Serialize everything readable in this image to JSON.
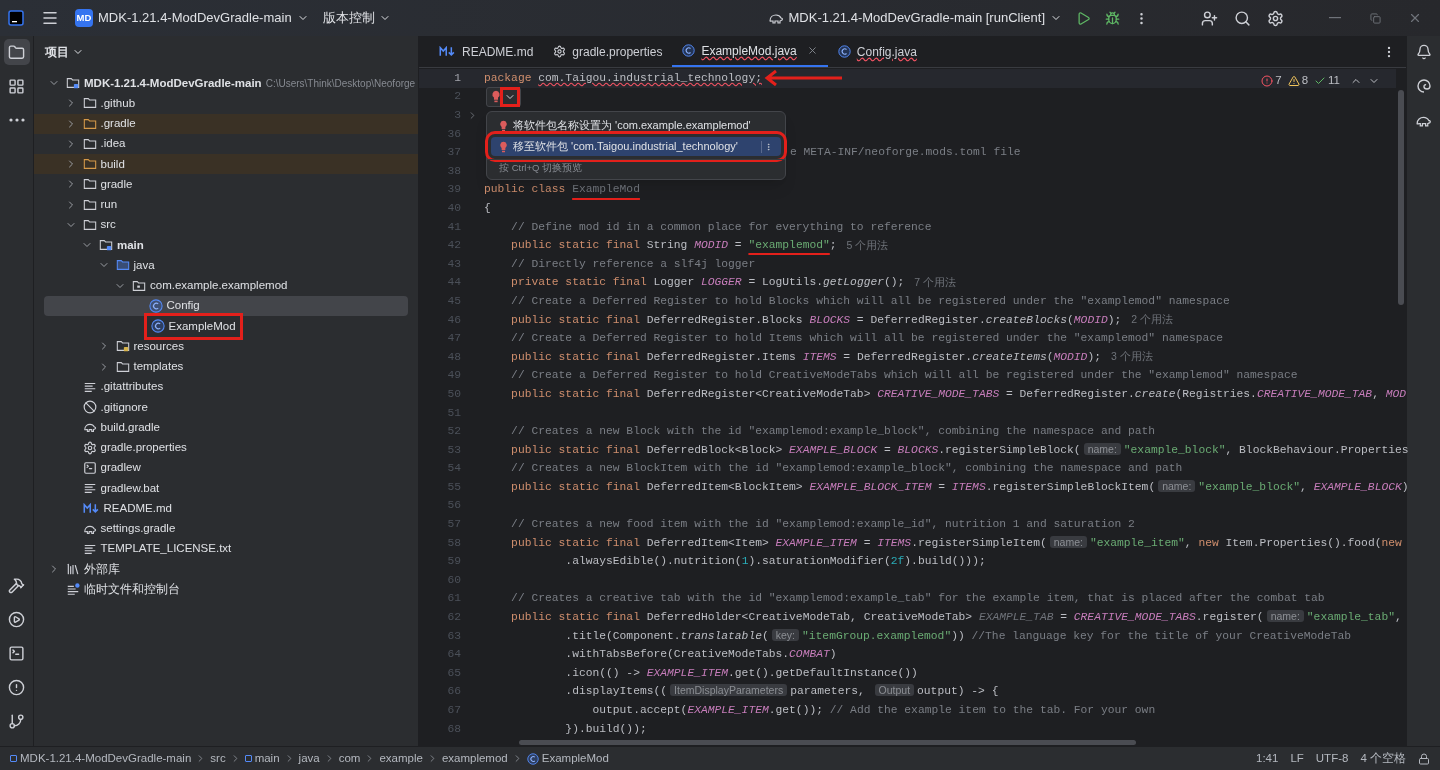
{
  "title_bar": {
    "project_badge": "MD",
    "project": "MDK-1.21.4-ModDevGradle-main",
    "vcs": "版本控制",
    "run_config": "MDK-1.21.4-ModDevGradle-main [runClient]"
  },
  "left_toolbar": [
    {
      "kind": "folder",
      "selected": true
    },
    {
      "kind": "structure",
      "selected": false
    },
    {
      "kind": "more",
      "selected": false
    }
  ],
  "left_toolbar_bottom": [
    {
      "kind": "build",
      "selected": false
    },
    {
      "kind": "run",
      "selected": false
    },
    {
      "kind": "terminal",
      "selected": false
    },
    {
      "kind": "problems",
      "selected": false
    },
    {
      "kind": "git",
      "selected": false
    }
  ],
  "right_toolbar": [
    {
      "kind": "notifications",
      "selected": false
    },
    {
      "kind": "assistant",
      "selected": false
    },
    {
      "kind": "gradle",
      "selected": false
    }
  ],
  "project_panel": {
    "title": "项目",
    "tree": [
      {
        "label": "MDK-1.21.4-ModDevGradle-main",
        "path": "C:\\Users\\Think\\Desktop\\Neoforge",
        "kind": "module",
        "bold": true,
        "expanded": true,
        "selected": false,
        "annotated": false,
        "children": [
          {
            "label": ".github",
            "kind": "folder",
            "bold": false,
            "expanded": false,
            "selected": false,
            "annotated": false
          },
          {
            "label": ".gradle",
            "kind": "excluded",
            "bold": false,
            "expanded": false,
            "selected": false,
            "annotated": false
          },
          {
            "label": ".idea",
            "kind": "folder",
            "bold": false,
            "expanded": false,
            "selected": false,
            "annotated": false
          },
          {
            "label": "build",
            "kind": "excluded",
            "bold": false,
            "expanded": false,
            "selected": false,
            "annotated": false
          },
          {
            "label": "gradle",
            "kind": "folder",
            "bold": false,
            "expanded": false,
            "selected": false,
            "annotated": false
          },
          {
            "label": "run",
            "kind": "folder",
            "bold": false,
            "expanded": false,
            "selected": false,
            "annotated": false
          },
          {
            "label": "src",
            "kind": "folder",
            "bold": false,
            "expanded": true,
            "selected": false,
            "annotated": false,
            "children": [
              {
                "label": "main",
                "kind": "module",
                "bold": true,
                "expanded": true,
                "selected": false,
                "annotated": false,
                "children": [
                  {
                    "label": "java",
                    "kind": "source",
                    "bold": false,
                    "expanded": true,
                    "selected": false,
                    "annotated": false,
                    "children": [
                      {
                        "label": "com.example.examplemod",
                        "kind": "package",
                        "bold": false,
                        "expanded": true,
                        "selected": false,
                        "annotated": false,
                        "children": [
                          {
                            "label": "Config",
                            "kind": "class",
                            "bold": false,
                            "selected": true,
                            "annotated": false
                          },
                          {
                            "label": "ExampleMod",
                            "kind": "class",
                            "bold": false,
                            "selected": false,
                            "annotated": true
                          }
                        ]
                      }
                    ]
                  },
                  {
                    "label": "resources",
                    "kind": "resources",
                    "bold": false,
                    "expanded": false,
                    "selected": false,
                    "annotated": false
                  },
                  {
                    "label": "templates",
                    "kind": "folder",
                    "bold": false,
                    "expanded": false,
                    "selected": false,
                    "annotated": false
                  }
                ]
              }
            ]
          },
          {
            "label": ".gitattributes",
            "kind": "text",
            "bold": false,
            "selected": false,
            "annotated": false
          },
          {
            "label": ".gitignore",
            "kind": "ignore",
            "bold": false,
            "selected": false,
            "annotated": false
          },
          {
            "label": "build.gradle",
            "kind": "gradle",
            "bold": false,
            "selected": false,
            "annotated": false
          },
          {
            "label": "gradle.properties",
            "kind": "settings",
            "bold": false,
            "selected": false,
            "annotated": false
          },
          {
            "label": "gradlew",
            "kind": "terminal",
            "bold": false,
            "selected": false,
            "annotated": false
          },
          {
            "label": "gradlew.bat",
            "kind": "text",
            "bold": false,
            "selected": false,
            "annotated": false
          },
          {
            "label": "README.md",
            "kind": "markdown",
            "bold": false,
            "selected": false,
            "annotated": false
          },
          {
            "label": "settings.gradle",
            "kind": "gradle",
            "bold": false,
            "selected": false,
            "annotated": false
          },
          {
            "label": "TEMPLATE_LICENSE.txt",
            "kind": "text",
            "bold": false,
            "selected": false,
            "annotated": false
          }
        ]
      },
      {
        "label": "外部库",
        "kind": "library",
        "bold": false,
        "expanded": false,
        "selected": false,
        "annotated": false
      },
      {
        "label": "临时文件和控制台",
        "kind": "scratch",
        "bold": false,
        "selected": false,
        "annotated": false
      }
    ]
  },
  "editor": {
    "tabs": [
      {
        "label": "README.md",
        "kind": "markdown",
        "selected": false,
        "error": false
      },
      {
        "label": "gradle.properties",
        "kind": "settings",
        "selected": false,
        "error": false
      },
      {
        "label": "ExampleMod.java",
        "kind": "class",
        "selected": true,
        "error": true
      },
      {
        "label": "Config.java",
        "kind": "class",
        "selected": false,
        "error": true
      }
    ],
    "inspections": {
      "errors": "7",
      "warnings": "8",
      "ok": "11"
    },
    "lines": [
      {
        "number": "1",
        "kind": "code",
        "current": true,
        "tokens": [
          {
            "kind": "keyword",
            "text": "package "
          },
          {
            "kind": "error",
            "text": "com.Taigou.industrial_technology;"
          },
          {
            "kind": "arrow"
          }
        ]
      },
      {
        "number": "2",
        "kind": "intention",
        "current": false,
        "annotated": true
      },
      {
        "number": "3",
        "kind": "fold",
        "current": false
      },
      {
        "number": "36",
        "kind": "code",
        "current": false
      },
      {
        "number": "37",
        "kind": "covered",
        "current": false,
        "tokens": [
          {
            "kind": "comment",
            "text": "e META-INF/neoforge.mods.toml file"
          }
        ]
      },
      {
        "number": "38",
        "kind": "code",
        "current": false
      },
      {
        "number": "39",
        "kind": "code",
        "current": false,
        "tokens": [
          {
            "kind": "keyword",
            "text": "public class "
          },
          {
            "kind": "unused-marked",
            "text": "ExampleMod"
          }
        ]
      },
      {
        "number": "40",
        "kind": "code",
        "current": false,
        "tokens": [
          {
            "kind": "plain",
            "text": "{"
          }
        ]
      },
      {
        "number": "41",
        "kind": "code",
        "current": false,
        "tokens": [
          {
            "kind": "comment",
            "text": "    // Define mod id in a common place for everything to reference"
          }
        ]
      },
      {
        "number": "42",
        "kind": "code",
        "current": false,
        "tokens": [
          {
            "kind": "keyword",
            "text": "    public static final "
          },
          {
            "kind": "plain",
            "text": "String "
          },
          {
            "kind": "field",
            "text": "MODID"
          },
          {
            "kind": "plain",
            "text": " = "
          },
          {
            "kind": "string-marked",
            "text": "\"examplemod\""
          },
          {
            "kind": "plain",
            "text": ";"
          },
          {
            "kind": "usage",
            "text": "5 个用法"
          }
        ]
      },
      {
        "number": "43",
        "kind": "code",
        "current": false,
        "tokens": [
          {
            "kind": "comment",
            "text": "    // Directly reference a slf4j logger"
          }
        ]
      },
      {
        "number": "44",
        "kind": "code",
        "current": false,
        "tokens": [
          {
            "kind": "keyword",
            "text": "    private static final "
          },
          {
            "kind": "plain",
            "text": "Logger "
          },
          {
            "kind": "field",
            "text": "LOGGER"
          },
          {
            "kind": "plain",
            "text": " = LogUtils."
          },
          {
            "kind": "method",
            "text": "getLogger"
          },
          {
            "kind": "plain",
            "text": "();"
          },
          {
            "kind": "usage",
            "text": "7 个用法"
          }
        ]
      },
      {
        "number": "45",
        "kind": "code",
        "current": false,
        "tokens": [
          {
            "kind": "comment",
            "text": "    // Create a Deferred Register to hold Blocks which will all be registered under the \"examplemod\" namespace"
          }
        ]
      },
      {
        "number": "46",
        "kind": "code",
        "current": false,
        "tokens": [
          {
            "kind": "keyword",
            "text": "    public static final "
          },
          {
            "kind": "plain",
            "text": "DeferredRegister.Blocks "
          },
          {
            "kind": "field",
            "text": "BLOCKS"
          },
          {
            "kind": "plain",
            "text": " = DeferredRegister."
          },
          {
            "kind": "method",
            "text": "createBlocks"
          },
          {
            "kind": "plain",
            "text": "("
          },
          {
            "kind": "field",
            "text": "MODID"
          },
          {
            "kind": "plain",
            "text": ");"
          },
          {
            "kind": "usage",
            "text": "2 个用法"
          }
        ]
      },
      {
        "number": "47",
        "kind": "code",
        "current": false,
        "tokens": [
          {
            "kind": "comment",
            "text": "    // Create a Deferred Register to hold Items which will all be registered under the \"examplemod\" namespace"
          }
        ]
      },
      {
        "number": "48",
        "kind": "code",
        "current": false,
        "tokens": [
          {
            "kind": "keyword",
            "text": "    public static final "
          },
          {
            "kind": "plain",
            "text": "DeferredRegister.Items "
          },
          {
            "kind": "field",
            "text": "ITEMS"
          },
          {
            "kind": "plain",
            "text": " = DeferredRegister."
          },
          {
            "kind": "method",
            "text": "createItems"
          },
          {
            "kind": "plain",
            "text": "("
          },
          {
            "kind": "field",
            "text": "MODID"
          },
          {
            "kind": "plain",
            "text": ");"
          },
          {
            "kind": "usage",
            "text": "3 个用法"
          }
        ]
      },
      {
        "number": "49",
        "kind": "code",
        "current": false,
        "tokens": [
          {
            "kind": "comment",
            "text": "    // Create a Deferred Register to hold CreativeModeTabs which will all be registered under the \"examplemod\" namespace"
          }
        ]
      },
      {
        "number": "50",
        "kind": "code",
        "current": false,
        "tokens": [
          {
            "kind": "keyword",
            "text": "    public static final "
          },
          {
            "kind": "plain",
            "text": "DeferredRegister<CreativeModeTab> "
          },
          {
            "kind": "field",
            "text": "CREATIVE_MODE_TABS"
          },
          {
            "kind": "plain",
            "text": " = DeferredRegister."
          },
          {
            "kind": "method",
            "text": "create"
          },
          {
            "kind": "plain",
            "text": "(Registries."
          },
          {
            "kind": "field",
            "text": "CREATIVE_MODE_TAB"
          },
          {
            "kind": "plain",
            "text": ", "
          },
          {
            "kind": "field",
            "text": "MOD"
          }
        ]
      },
      {
        "number": "51",
        "kind": "code",
        "current": false
      },
      {
        "number": "52",
        "kind": "code",
        "current": false,
        "tokens": [
          {
            "kind": "comment",
            "text": "    // Creates a new Block with the id \"examplemod:example_block\", combining the namespace and path"
          }
        ]
      },
      {
        "number": "53",
        "kind": "code",
        "current": false,
        "tokens": [
          {
            "kind": "keyword",
            "text": "    public static final "
          },
          {
            "kind": "plain",
            "text": "DeferredBlock<Block> "
          },
          {
            "kind": "field",
            "text": "EXAMPLE_BLOCK"
          },
          {
            "kind": "plain",
            "text": " = "
          },
          {
            "kind": "field",
            "text": "BLOCKS"
          },
          {
            "kind": "plain",
            "text": ".registerSimpleBlock("
          },
          {
            "kind": "hint",
            "text": "name:"
          },
          {
            "kind": "string",
            "text": "\"example_block\""
          },
          {
            "kind": "plain",
            "text": ", BlockBehaviour.Properties"
          }
        ]
      },
      {
        "number": "54",
        "kind": "code",
        "current": false,
        "tokens": [
          {
            "kind": "comment",
            "text": "    // Creates a new BlockItem with the id \"examplemod:example_block\", combining the namespace and path"
          }
        ]
      },
      {
        "number": "55",
        "kind": "code",
        "current": false,
        "tokens": [
          {
            "kind": "keyword",
            "text": "    public static final "
          },
          {
            "kind": "plain",
            "text": "DeferredItem<BlockItem> "
          },
          {
            "kind": "field",
            "text": "EXAMPLE_BLOCK_ITEM"
          },
          {
            "kind": "plain",
            "text": " = "
          },
          {
            "kind": "field",
            "text": "ITEMS"
          },
          {
            "kind": "plain",
            "text": ".registerSimpleBlockItem("
          },
          {
            "kind": "hint",
            "text": "name:"
          },
          {
            "kind": "string",
            "text": "\"example_block\""
          },
          {
            "kind": "plain",
            "text": ", "
          },
          {
            "kind": "field",
            "text": "EXAMPLE_BLOCK"
          },
          {
            "kind": "plain",
            "text": ")"
          }
        ]
      },
      {
        "number": "56",
        "kind": "code",
        "current": false
      },
      {
        "number": "57",
        "kind": "code",
        "current": false,
        "tokens": [
          {
            "kind": "comment",
            "text": "    // Creates a new food item with the id \"examplemod:example_id\", nutrition 1 and saturation 2"
          }
        ]
      },
      {
        "number": "58",
        "kind": "code",
        "current": false,
        "tokens": [
          {
            "kind": "keyword",
            "text": "    public static final "
          },
          {
            "kind": "plain",
            "text": "DeferredItem<Item> "
          },
          {
            "kind": "field",
            "text": "EXAMPLE_ITEM"
          },
          {
            "kind": "plain",
            "text": " = "
          },
          {
            "kind": "field",
            "text": "ITEMS"
          },
          {
            "kind": "plain",
            "text": ".registerSimpleItem("
          },
          {
            "kind": "hint",
            "text": "name:"
          },
          {
            "kind": "string",
            "text": "\"example_item\""
          },
          {
            "kind": "plain",
            "text": ", "
          },
          {
            "kind": "keyword",
            "text": "new "
          },
          {
            "kind": "plain",
            "text": "Item.Properties().food("
          },
          {
            "kind": "keyword",
            "text": "new"
          }
        ]
      },
      {
        "number": "59",
        "kind": "code",
        "current": false,
        "tokens": [
          {
            "kind": "plain",
            "text": "            .alwaysEdible().nutrition("
          },
          {
            "kind": "number",
            "text": "1"
          },
          {
            "kind": "plain",
            "text": ").saturationModifier("
          },
          {
            "kind": "number",
            "text": "2f"
          },
          {
            "kind": "plain",
            "text": ").build()));"
          }
        ]
      },
      {
        "number": "60",
        "kind": "code",
        "current": false
      },
      {
        "number": "61",
        "kind": "code",
        "current": false,
        "tokens": [
          {
            "kind": "comment",
            "text": "    // Creates a creative tab with the id \"examplemod:example_tab\" for the example item, that is placed after the combat tab"
          }
        ]
      },
      {
        "number": "62",
        "kind": "code",
        "current": false,
        "tokens": [
          {
            "kind": "keyword",
            "text": "    public static final "
          },
          {
            "kind": "plain",
            "text": "DeferredHolder<CreativeModeTab, CreativeModeTab> "
          },
          {
            "kind": "unused-field",
            "text": "EXAMPLE_TAB"
          },
          {
            "kind": "plain",
            "text": " = "
          },
          {
            "kind": "field",
            "text": "CREATIVE_MODE_TABS"
          },
          {
            "kind": "plain",
            "text": ".register("
          },
          {
            "kind": "hint",
            "text": "name:"
          },
          {
            "kind": "string",
            "text": "\"example_tab\""
          },
          {
            "kind": "plain",
            "text": ","
          }
        ]
      },
      {
        "number": "63",
        "kind": "code",
        "current": false,
        "tokens": [
          {
            "kind": "plain",
            "text": "            .title(Component."
          },
          {
            "kind": "method",
            "text": "translatable"
          },
          {
            "kind": "plain",
            "text": "("
          },
          {
            "kind": "hint",
            "text": "key:"
          },
          {
            "kind": "string",
            "text": "\"itemGroup.examplemod\""
          },
          {
            "kind": "plain",
            "text": "))"
          },
          {
            "kind": "comment",
            "text": " //The language key for the title of your CreativeModeTab"
          }
        ]
      },
      {
        "number": "64",
        "kind": "code",
        "current": false,
        "tokens": [
          {
            "kind": "plain",
            "text": "            .withTabsBefore(CreativeModeTabs."
          },
          {
            "kind": "field",
            "text": "COMBAT"
          },
          {
            "kind": "plain",
            "text": ")"
          }
        ]
      },
      {
        "number": "65",
        "kind": "code",
        "current": false,
        "tokens": [
          {
            "kind": "plain",
            "text": "            .icon(() -> "
          },
          {
            "kind": "field",
            "text": "EXAMPLE_ITEM"
          },
          {
            "kind": "plain",
            "text": ".get().getDefaultInstance())"
          }
        ]
      },
      {
        "number": "66",
        "kind": "code",
        "current": false,
        "tokens": [
          {
            "kind": "plain",
            "text": "            .displayItems(("
          },
          {
            "kind": "hint",
            "text": "ItemDisplayParameters"
          },
          {
            "kind": "plain",
            "text": "parameters, "
          },
          {
            "kind": "hint",
            "text": "Output"
          },
          {
            "kind": "plain",
            "text": "output) -> {"
          }
        ]
      },
      {
        "number": "67",
        "kind": "code",
        "current": false,
        "tokens": [
          {
            "kind": "plain",
            "text": "                output.accept("
          },
          {
            "kind": "field",
            "text": "EXAMPLE_ITEM"
          },
          {
            "kind": "plain",
            "text": ".get());"
          },
          {
            "kind": "comment",
            "text": " // Add the example item to the tab. For your own"
          }
        ]
      },
      {
        "number": "68",
        "kind": "code",
        "current": false,
        "tokens": [
          {
            "kind": "plain",
            "text": "            }).build());"
          }
        ]
      }
    ],
    "intention_popup": {
      "items": [
        {
          "label": "将软件包名称设置为 'com.example.examplemod'",
          "selected": false,
          "annotated": false
        },
        {
          "label": "移至软件包 'com.Taigou.industrial_technology'",
          "selected": true,
          "annotated": true
        }
      ],
      "footer": "按 Ctrl+Q 切换预览"
    }
  },
  "status_bar": {
    "breadcrumbs": [
      {
        "label": "MDK-1.21.4-ModDevGradle-main",
        "kind": "module"
      },
      {
        "label": "src",
        "kind": "plain"
      },
      {
        "label": "main",
        "kind": "module"
      },
      {
        "label": "java",
        "kind": "plain"
      },
      {
        "label": "com",
        "kind": "plain"
      },
      {
        "label": "example",
        "kind": "plain"
      },
      {
        "label": "examplemod",
        "kind": "plain"
      },
      {
        "label": "ExampleMod",
        "kind": "class"
      }
    ],
    "position": "1:41",
    "line_ending": "LF",
    "encoding": "UTF-8",
    "indent": "4 个空格"
  }
}
